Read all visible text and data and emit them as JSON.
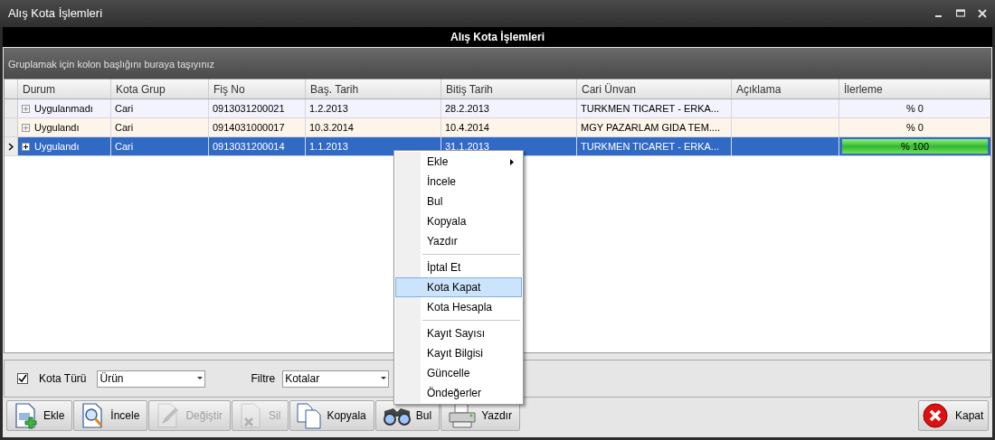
{
  "window": {
    "title": "Alış Kota İşlemleri"
  },
  "header": {
    "title": "Alış Kota İşlemleri"
  },
  "group_panel": {
    "hint": "Gruplamak için kolon başlığını buraya taşıyınız"
  },
  "table": {
    "columns": [
      "Durum",
      "Kota Grup",
      "Fiş No",
      "Baş. Tarih",
      "Bitiş Tarih",
      "Cari Ünvan",
      "Açıklama",
      "İlerleme"
    ],
    "rows": [
      {
        "selected": false,
        "cells": [
          "Uygulanmadı",
          "Cari",
          "0913031200021",
          "1.2.2013",
          "28.2.2013",
          "TURKMEN TICARET - ERKA...",
          ""
        ],
        "progress": "% 0",
        "level": 0
      },
      {
        "selected": false,
        "cells": [
          "Uygulandı",
          "Cari",
          "0914031000017",
          "10.3.2014",
          "10.4.2014",
          "MGY PAZARLAM GIDA TEM....",
          ""
        ],
        "progress": "% 0",
        "level": 0
      },
      {
        "selected": true,
        "cells": [
          "Uygulandı",
          "Cari",
          "0913031200014",
          "1.1.2013",
          "31.1.2013",
          "TURKMEN TICARET - ERKA...",
          ""
        ],
        "progress": "% 100",
        "level": 1
      }
    ]
  },
  "context_menu": [
    {
      "kind": "item",
      "label": "Ekle",
      "submenu": true,
      "selected": false
    },
    {
      "kind": "item",
      "label": "İncele",
      "submenu": false,
      "selected": false
    },
    {
      "kind": "item",
      "label": "Bul",
      "submenu": false,
      "selected": false
    },
    {
      "kind": "item",
      "label": "Kopyala",
      "submenu": false,
      "selected": false
    },
    {
      "kind": "item",
      "label": "Yazdır",
      "submenu": false,
      "selected": false
    },
    {
      "kind": "separator"
    },
    {
      "kind": "item",
      "label": "İptal Et",
      "submenu": false,
      "selected": false
    },
    {
      "kind": "item",
      "label": "Kota Kapat",
      "submenu": false,
      "selected": true
    },
    {
      "kind": "item",
      "label": "Kota Hesapla",
      "submenu": false,
      "selected": false
    },
    {
      "kind": "separator"
    },
    {
      "kind": "item",
      "label": "Kayıt Sayısı",
      "submenu": false,
      "selected": false
    },
    {
      "kind": "item",
      "label": "Kayıt Bilgisi",
      "submenu": false,
      "selected": false
    },
    {
      "kind": "item",
      "label": "Güncelle",
      "submenu": false,
      "selected": false
    },
    {
      "kind": "item",
      "label": "Öndeğerler",
      "submenu": false,
      "selected": false
    }
  ],
  "filters": {
    "kota_turu": {
      "label": "Kota Türü",
      "checked": true,
      "value": "Ürün"
    },
    "filtre": {
      "label": "Filtre",
      "value": "Kotalar"
    }
  },
  "toolbar": [
    {
      "label": "Ekle",
      "kind": "add",
      "disabled": false
    },
    {
      "label": "İncele",
      "kind": "inspect",
      "disabled": false
    },
    {
      "label": "Değiştir",
      "kind": "edit",
      "disabled": true
    },
    {
      "label": "Sil",
      "kind": "delete",
      "disabled": true
    },
    {
      "label": "Kopyala",
      "kind": "copy",
      "disabled": false
    },
    {
      "label": "Bul",
      "kind": "find",
      "disabled": false
    },
    {
      "label": "Yazdır",
      "kind": "print",
      "disabled": false
    }
  ],
  "close_button": {
    "label": "Kapat"
  }
}
